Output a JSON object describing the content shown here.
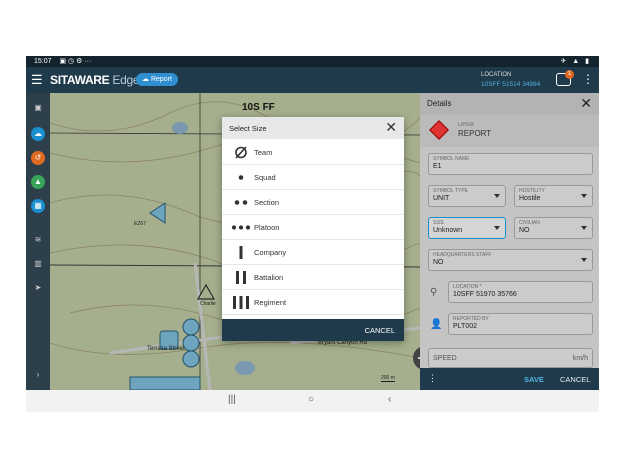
{
  "status_bar": {
    "time": "15:07",
    "icons_left": "▣ ◷ ⚙ ···",
    "icons_right": "✈ ▲ ▮"
  },
  "app_bar": {
    "brand_bold": "SITAWARE",
    "brand_light": " Edge",
    "report_pill": "Report",
    "location_label": "LOCATION",
    "location_value": "10SFF 51514 34994",
    "notification_count": "1"
  },
  "map": {
    "grid_label": "10S FF",
    "scale": "200 m",
    "labels": [
      "EZ67",
      "Charlie",
      "Terraza Street",
      "Bryant Canyon Rd"
    ]
  },
  "details": {
    "title": "Details",
    "layer_label": "LAYER",
    "layer_value": "REPORT",
    "symbol_name": {
      "label": "SYMBOL NAME",
      "value": "E1"
    },
    "symbol_type": {
      "label": "SYMBOL TYPE",
      "value": "UNIT"
    },
    "hostility": {
      "label": "HOSTILITY",
      "value": "Hostile"
    },
    "size": {
      "label": "SIZE",
      "value": "Unknown"
    },
    "civilian": {
      "label": "CIVILIAN",
      "value": "NO"
    },
    "headquarters_staff": {
      "label": "HEADQUARTERS STAFF",
      "value": "NO"
    },
    "location": {
      "label": "LOCATION *",
      "value": "10SFF 51970 35766"
    },
    "reported_by": {
      "label": "REPORTED BY",
      "value": "PLT002"
    },
    "speed": {
      "label": "SPEED",
      "unit": "km/h"
    },
    "save_label": "SAVE",
    "cancel_label": "CANCEL",
    "accent": "#1a8fd0",
    "hostile_color": "#dd3333"
  },
  "dialog": {
    "title": "Select Size",
    "cancel_label": "CANCEL",
    "options": [
      {
        "label": "Team",
        "icon": "team-icon"
      },
      {
        "label": "Squad",
        "icon": "squad-icon"
      },
      {
        "label": "Section",
        "icon": "section-icon"
      },
      {
        "label": "Platoon",
        "icon": "platoon-icon"
      },
      {
        "label": "Company",
        "icon": "company-icon"
      },
      {
        "label": "Battalion",
        "icon": "battalion-icon"
      },
      {
        "label": "Regiment",
        "icon": "regiment-icon"
      }
    ]
  }
}
